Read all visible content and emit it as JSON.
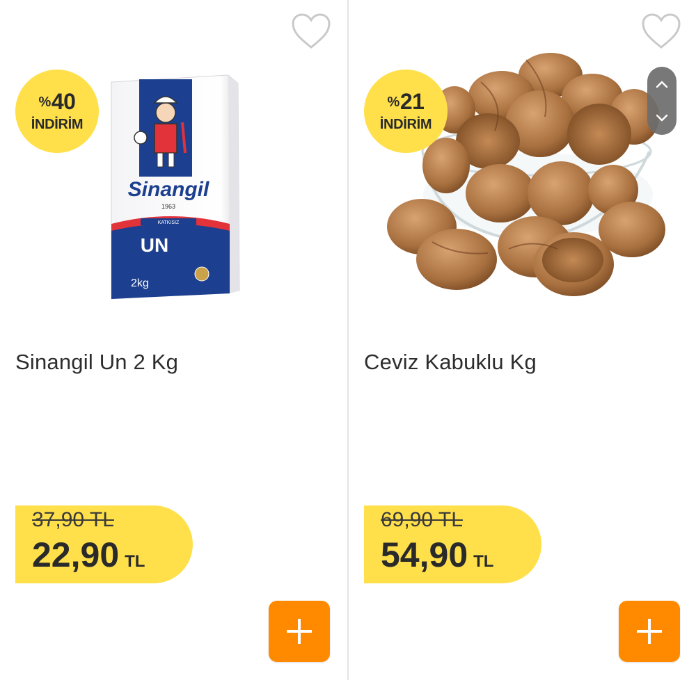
{
  "products": [
    {
      "name": "Sinangil Un 2 Kg",
      "discount_symbol": "%",
      "discount_value": "40",
      "discount_label": "İNDİRİM",
      "old_price": "37,90 TL",
      "new_price": "22,90",
      "currency": "TL",
      "image_icon": "flour-bag-image",
      "image_text": {
        "brand": "Sinangil",
        "year": "1963",
        "tag": "KATKISIZ",
        "product": "UN",
        "weight": "2kg"
      }
    },
    {
      "name": "Ceviz Kabuklu Kg",
      "discount_symbol": "%",
      "discount_value": "21",
      "discount_label": "İNDİRİM",
      "old_price": "69,90 TL",
      "new_price": "54,90",
      "currency": "TL",
      "image_icon": "walnut-bowl-image"
    }
  ],
  "colors": {
    "badge": "#ffe04a",
    "add_button": "#ff8a00",
    "scroll": "#6d6d6d"
  },
  "icons": {
    "favorite": "heart-outline-icon",
    "add": "plus-icon",
    "scroll_up": "chevron-up-icon",
    "scroll_down": "chevron-down-icon"
  }
}
